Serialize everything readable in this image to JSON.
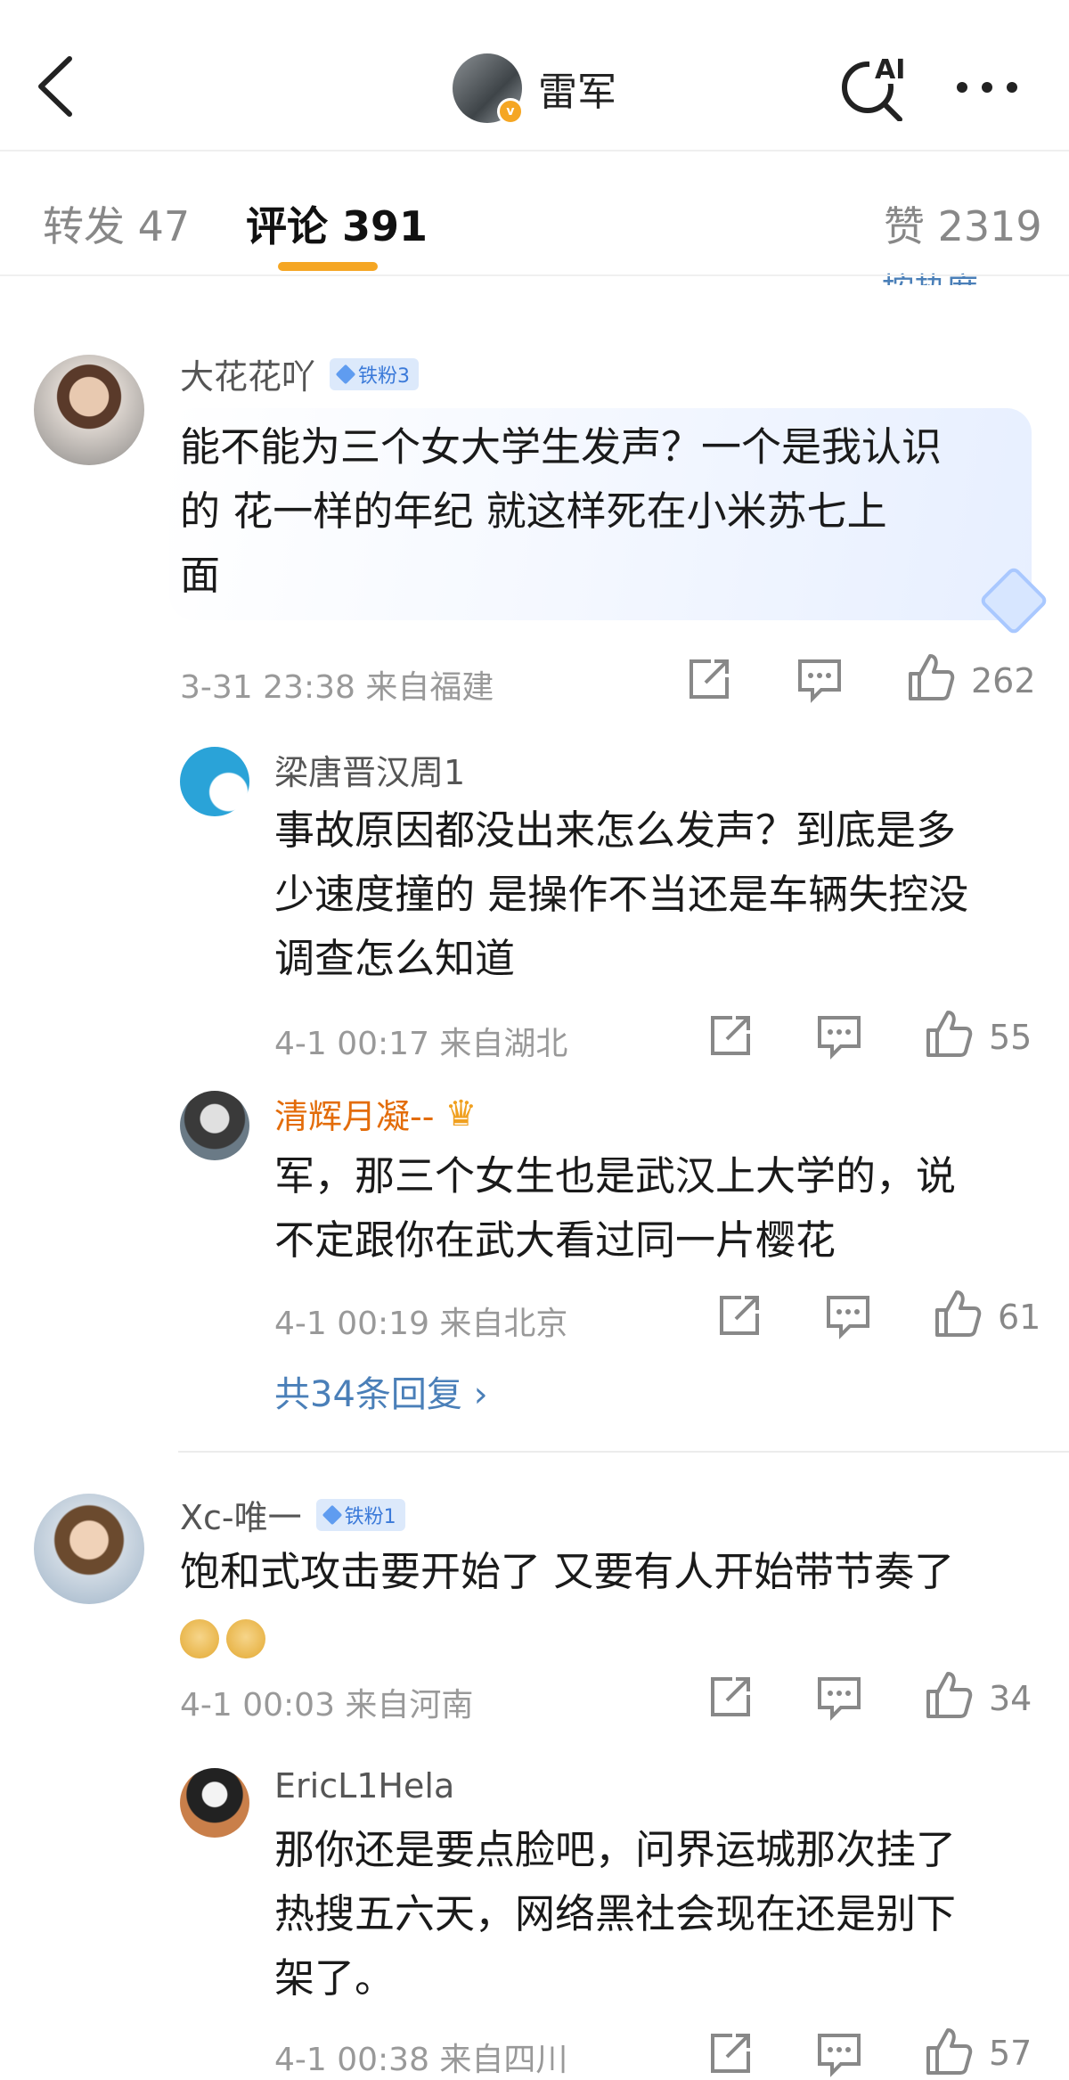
{
  "header": {
    "title": "雷军",
    "ai_label": "AI"
  },
  "tabs": [
    {
      "label": "转发 47"
    },
    {
      "label": "评论 391"
    },
    {
      "label": "赞 2319"
    }
  ],
  "sort_peek": "按热度",
  "comments": [
    {
      "user": "大花花吖",
      "badge": "铁粉3",
      "lines": [
        "能不能为三个女大学生发声？一个是我认识",
        "的  花一样的年纪  就这样死在小米苏七上",
        "面"
      ],
      "time_loc": "3-31 23:38  来自福建",
      "likes": "262",
      "replies": [
        {
          "user": "梁唐晋汉周1",
          "lines": [
            "事故原因都没出来怎么发声？到底是多",
            "少速度撞的 是操作不当还是车辆失控没",
            "调查怎么知道"
          ],
          "time_loc": "4-1 00:17  来自湖北",
          "likes": "55"
        },
        {
          "user": "清辉月凝--",
          "lines": [
            "军，那三个女生也是武汉上大学的，说",
            "不定跟你在武大看过同一片樱花"
          ],
          "time_loc": "4-1 00:19  来自北京",
          "likes": "61"
        }
      ],
      "more_replies": "共34条回复 ›"
    },
    {
      "user": "Xc-唯一",
      "badge": "铁粉1",
      "lines": [
        "饱和式攻击要开始了 又要有人开始带节奏了"
      ],
      "time_loc": "4-1 00:03  来自河南",
      "likes": "34",
      "replies": [
        {
          "user": "EricL1Hela",
          "lines": [
            "那你还是要点脸吧，问界运城那次挂了",
            "热搜五六天，网络黑社会现在还是别下",
            "架了。"
          ],
          "time_loc": "4-1 00:38  来自四川",
          "likes": "57"
        }
      ]
    }
  ],
  "icons": {
    "back": "chevron-left-icon",
    "ai": "ai-search-icon",
    "more": "more-dots-icon",
    "share": "share-icon",
    "comment": "comment-icon",
    "like": "thumbs-up-icon",
    "badge": "diamond-icon",
    "crown": "crown-icon",
    "emoji": "doge-emoji-icon"
  },
  "colors": {
    "accent": "#f5a623",
    "link": "#4a7fb8",
    "vip_name": "#e36c0a",
    "badge_bg": "#dce9fb"
  }
}
